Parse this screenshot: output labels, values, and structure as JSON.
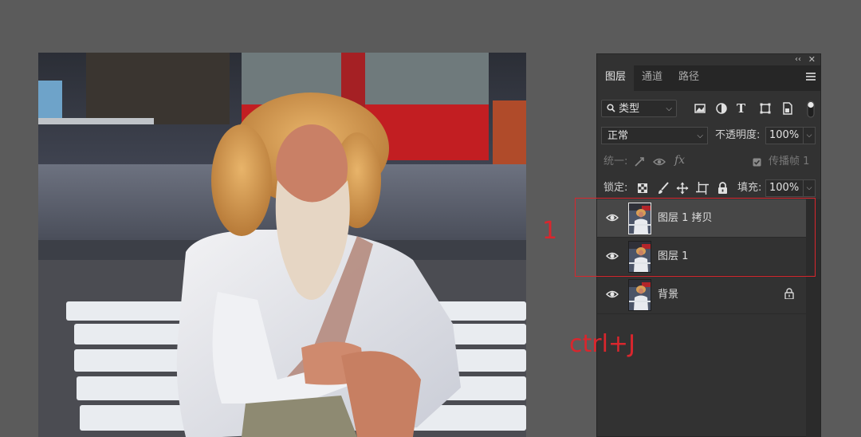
{
  "panel": {
    "collapse_glyph": "‹‹",
    "close_glyph": "✕",
    "tabs": [
      {
        "label": "图层",
        "active": true
      },
      {
        "label": "通道",
        "active": false
      },
      {
        "label": "路径",
        "active": false
      }
    ],
    "filter": {
      "label": "类型",
      "icon": "search-icon"
    },
    "blend_mode": "正常",
    "opacity_label": "不透明度:",
    "opacity_value": "100%",
    "unify_label": "统一:",
    "propagate_label": "传播帧 1",
    "lock_label": "锁定:",
    "fill_label": "填充:",
    "fill_value": "100%"
  },
  "layers": [
    {
      "name": "图层 1 拷贝",
      "visible": true,
      "selected": true,
      "locked": false
    },
    {
      "name": "图层 1",
      "visible": true,
      "selected": false,
      "locked": false
    },
    {
      "name": "背景",
      "visible": true,
      "selected": false,
      "locked": true
    }
  ],
  "annotations": {
    "number": "1",
    "shortcut": "ctrl+J",
    "color": "#d9262d"
  }
}
